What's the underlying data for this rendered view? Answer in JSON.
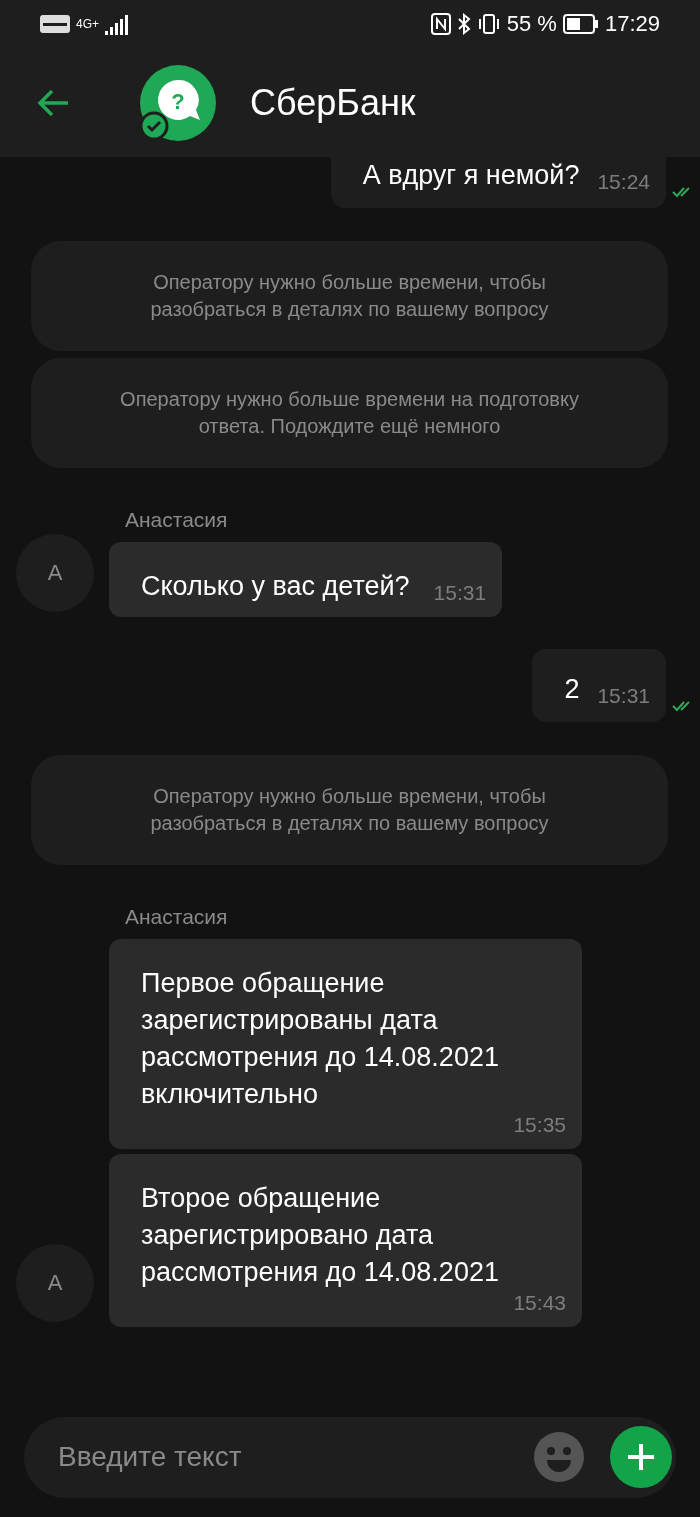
{
  "status_bar": {
    "network": "4G+",
    "battery": "55 %",
    "time": "17:29"
  },
  "header": {
    "logo_mark": "?",
    "title": "СберБанк"
  },
  "messages": [
    {
      "kind": "outgoing",
      "text": "А вдруг я немой?",
      "time": "15:24",
      "read": true
    },
    {
      "kind": "system",
      "text": "Оператору нужно больше времени, чтобы разобраться в деталях по вашему вопросу"
    },
    {
      "kind": "system",
      "text": "Оператору нужно больше времени на подготовку ответа. Подождите ещё немного"
    },
    {
      "kind": "incoming",
      "sender": "Анастасия",
      "avatar": "А",
      "text": "Сколько у вас детей?",
      "time": "15:31"
    },
    {
      "kind": "outgoing",
      "text": "2",
      "time": "15:31",
      "read": true
    },
    {
      "kind": "system",
      "text": "Оператору нужно больше времени, чтобы разобраться в деталях по вашему вопросу"
    },
    {
      "kind": "incoming",
      "sender": "Анастасия",
      "text": "Первое обращение зарегистрированы дата рассмотрения до 14.08.2021 включительно",
      "time": "15:35"
    },
    {
      "kind": "incoming",
      "avatar": "А",
      "text": "Второе обращение зарегистрировано дата рассмотрения до 14.08.2021",
      "time": "15:43"
    }
  ],
  "composer": {
    "placeholder": "Введите текст"
  }
}
